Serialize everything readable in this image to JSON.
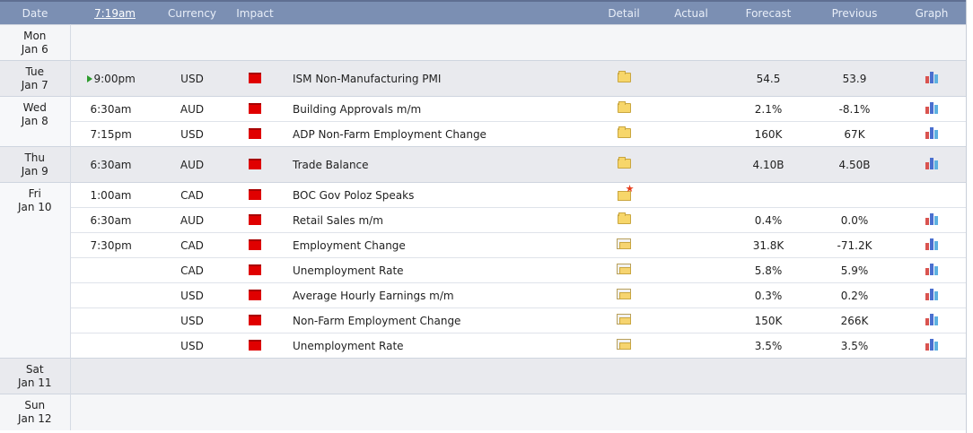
{
  "header": {
    "date": "Date",
    "time": "7:19am",
    "currency": "Currency",
    "impact": "Impact",
    "detail": "Detail",
    "actual": "Actual",
    "forecast": "Forecast",
    "previous": "Previous",
    "graph": "Graph"
  },
  "days": {
    "mon": {
      "day": "Mon",
      "date": "Jan 6"
    },
    "tue": {
      "day": "Tue",
      "date": "Jan 7"
    },
    "wed": {
      "day": "Wed",
      "date": "Jan 8"
    },
    "thu": {
      "day": "Thu",
      "date": "Jan 9"
    },
    "fri": {
      "day": "Fri",
      "date": "Jan 10"
    },
    "sat": {
      "day": "Sat",
      "date": "Jan 11"
    },
    "sun": {
      "day": "Sun",
      "date": "Jan 12"
    }
  },
  "events": [
    {
      "time": "9:00pm",
      "currency": "USD",
      "event": "ISM Non-Manufacturing PMI",
      "forecast": "54.5",
      "previous": "53.9"
    },
    {
      "time": "6:30am",
      "currency": "AUD",
      "event": "Building Approvals m/m",
      "forecast": "2.1%",
      "previous": "-8.1%"
    },
    {
      "time": "7:15pm",
      "currency": "USD",
      "event": "ADP Non-Farm Employment Change",
      "forecast": "160K",
      "previous": "67K"
    },
    {
      "time": "6:30am",
      "currency": "AUD",
      "event": "Trade Balance",
      "forecast": "4.10B",
      "previous": "4.50B"
    },
    {
      "time": "1:00am",
      "currency": "CAD",
      "event": "BOC Gov Poloz Speaks",
      "forecast": "",
      "previous": ""
    },
    {
      "time": "6:30am",
      "currency": "AUD",
      "event": "Retail Sales m/m",
      "forecast": "0.4%",
      "previous": "0.0%"
    },
    {
      "time": "7:30pm",
      "currency": "CAD",
      "event": "Employment Change",
      "forecast": "31.8K",
      "previous": "-71.2K"
    },
    {
      "time": "",
      "currency": "CAD",
      "event": "Unemployment Rate",
      "forecast": "5.8%",
      "previous": "5.9%"
    },
    {
      "time": "",
      "currency": "USD",
      "event": "Average Hourly Earnings m/m",
      "forecast": "0.3%",
      "previous": "0.2%"
    },
    {
      "time": "",
      "currency": "USD",
      "event": "Non-Farm Employment Change",
      "forecast": "150K",
      "previous": "266K"
    },
    {
      "time": "",
      "currency": "USD",
      "event": "Unemployment Rate",
      "forecast": "3.5%",
      "previous": "3.5%"
    }
  ],
  "icons": {
    "impact": "high-impact-icon",
    "detail": "folder-icon",
    "detail_open": "folder-open-icon",
    "detail_star": "folder-star-icon",
    "graph": "bar-chart-icon",
    "current": "play-icon"
  },
  "colors": {
    "header_bg": "#7b8fb3",
    "impact_high": "#e00000",
    "shade_row": "#e9eaee"
  }
}
